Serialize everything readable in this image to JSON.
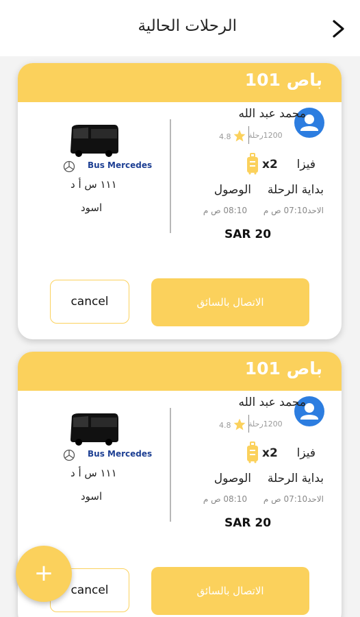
{
  "header": {
    "title": "الرحلات الحالية",
    "back_icon": "chevron-right-icon"
  },
  "trips": [
    {
      "bus_no": "باص 101",
      "driver_name": "محمد عبد الله",
      "trips_count": "1200رحلة",
      "rating": "4.8",
      "payment": "فيزا",
      "bags": "x2",
      "start_label": "بداية الرحلة",
      "arrive_label": "الوصول",
      "start_time": "الاحد07:10 ص م",
      "arrive_time": "08:10 ص م",
      "price": "SAR 20",
      "bus_brand": "Bus Mercedes",
      "plate": "١١١ س أ د",
      "bus_color": "اسود",
      "call_label": "الاتصال بالسائق",
      "cancel_label": "cancel"
    },
    {
      "bus_no": "باص 101",
      "driver_name": "محمد عبد الله",
      "trips_count": "1200رحلة",
      "rating": "4.8",
      "payment": "فيزا",
      "bags": "x2",
      "start_label": "بداية الرحلة",
      "arrive_label": "الوصول",
      "start_time": "الاحد07:10 ص م",
      "arrive_time": "08:10 ص م",
      "price": "SAR 20",
      "bus_brand": "Bus Mercedes",
      "plate": "١١١ س أ د",
      "bus_color": "اسود",
      "call_label": "الاتصال بالسائق",
      "cancel_label": "cancel"
    }
  ],
  "fab": {
    "label": "+"
  },
  "colors": {
    "accent": "#fbd15c",
    "avatar": "#2c7de0",
    "brand_text": "#1d3f93"
  }
}
